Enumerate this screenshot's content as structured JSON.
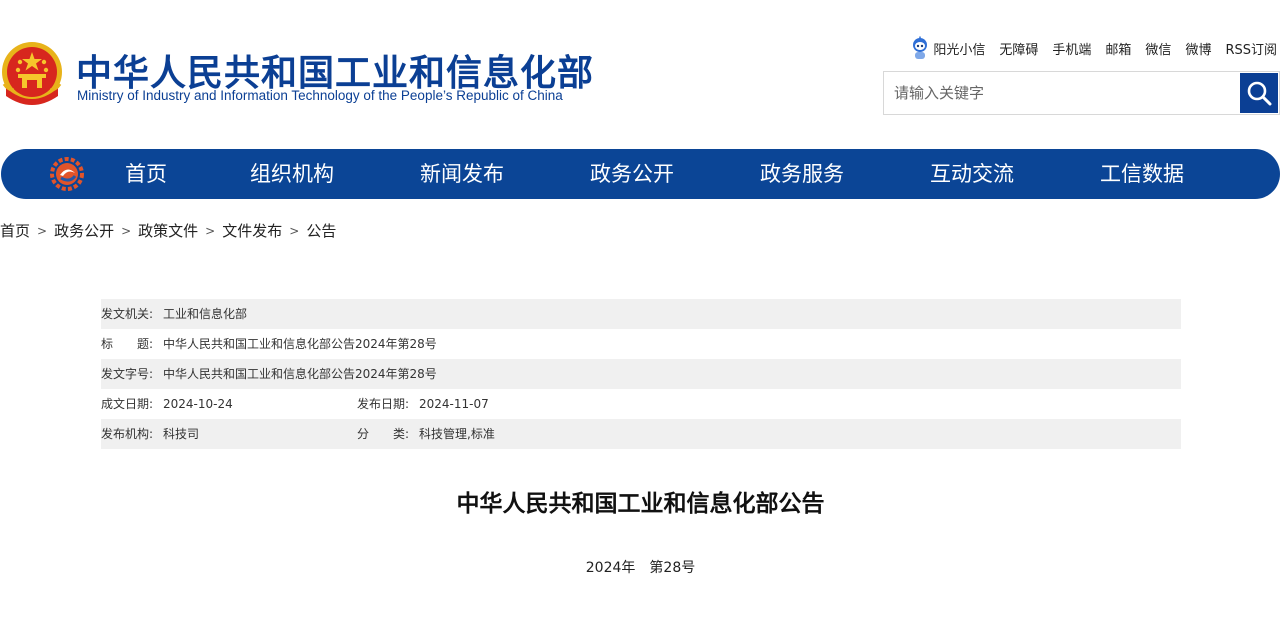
{
  "header": {
    "title": "中华人民共和国工业和信息化部",
    "subtitle": "Ministry of Industry and Information Technology of the People’s Republic of China",
    "emblem_icon": "national-emblem-icon"
  },
  "toplinks": {
    "assistant": "阳光小信",
    "accessibility": "无障碍",
    "mobile": "手机端",
    "mail": "邮箱",
    "wechat": "微信",
    "weibo": "微博",
    "rss": "RSS订阅"
  },
  "search": {
    "placeholder": "请输入关键字",
    "icon": "search-icon"
  },
  "nav": {
    "logo_icon": "miit-gear-logo-icon",
    "items": [
      "首页",
      "组织机构",
      "新闻发布",
      "政务公开",
      "政务服务",
      "互动交流",
      "工信数据"
    ]
  },
  "breadcrumb": {
    "items": [
      "首页",
      "政务公开",
      "政策文件",
      "文件发布",
      "公告"
    ],
    "separator": ">"
  },
  "info": {
    "issuer_label": "发文机关:",
    "issuer": "工业和信息化部",
    "title_label": "标　　题:",
    "title": "中华人民共和国工业和信息化部公告2024年第28号",
    "docno_label": "发文字号:",
    "docno": "中华人民共和国工业和信息化部公告2024年第28号",
    "written_label": "成文日期:",
    "written": "2024-10-24",
    "published_label": "发布日期:",
    "published": "2024-11-07",
    "org_label": "发布机构:",
    "org": "科技司",
    "category_label": "分　　类:",
    "category": "科技管理,标准"
  },
  "document": {
    "title": "中华人民共和国工业和信息化部公告",
    "year": "2024年",
    "number": "第28号"
  },
  "colors": {
    "brand_blue": "#0b3f94",
    "nav_blue": "#0b4596",
    "row_shade": "#f0f0f0"
  }
}
